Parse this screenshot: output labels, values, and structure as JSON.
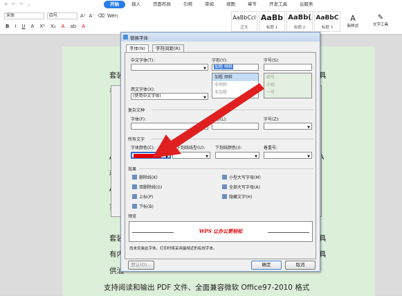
{
  "menubar": {
    "quick": [
      "✉",
      "↶",
      "↷",
      "⌄"
    ],
    "tabs": [
      "开始",
      "插入",
      "页面布局",
      "引用",
      "审阅",
      "视图",
      "章节",
      "开发工具",
      "云服务"
    ],
    "active": "开始"
  },
  "ribbon": {
    "font_name": "宋体",
    "font_size": "四号",
    "btns_row1": [
      "A⁺",
      "A⁻",
      "⌫",
      "Wén"
    ],
    "btns_row2": [
      "B",
      "I",
      "U",
      "A",
      "X²",
      "X₂",
      "A",
      "ab",
      "A"
    ],
    "styles": [
      {
        "sample": "AaBbCcl",
        "caption": "正文"
      },
      {
        "sample": "AaBb",
        "caption": "标题 1"
      },
      {
        "sample": "AaBb(",
        "caption": "标题 2"
      },
      {
        "sample": "AaBbC",
        "caption": "标题 3"
      }
    ],
    "new_style": "新样式",
    "tools": "文字工具"
  },
  "doc": {
    "lines": [
      "套装",
      "有内",
      "优",
      "A",
      "稻",
      "A",
      "首",
      "套装",
      "有内",
      "供油",
      "支持阅读和输出 PDF 文件、全面兼容微软 Office97-2010 格式"
    ],
    "right_marks": [
      "具",
      "A",
      "具",
      "具"
    ]
  },
  "dialog": {
    "title": "替换字体",
    "tabs": [
      "字体(N)",
      "字符间距(R)"
    ],
    "cn_font_label": "中文字体(T):",
    "style_label": "字形(Y):",
    "size_label": "字号(S):",
    "style_value": "加粗 倾斜",
    "style_list": [
      "加粗 倾斜",
      "非倾斜",
      "非加粗"
    ],
    "size_list": [
      "初号",
      "小初",
      "一号"
    ],
    "west_font_label": "西文字体(X):",
    "west_font_value": "(使用中文字体)",
    "complex_section": "复杂文种",
    "cfont_label": "字体(F):",
    "cstyle_label": "字形(L):",
    "csize_label": "字号(Z):",
    "all_text": "所有文字",
    "color_label": "字体颜色(C):",
    "ul_type_label": "下划线线型(U):",
    "ul_color_label": "下划线颜色(I):",
    "emphasis_label": "着重号:",
    "effects": "效果",
    "effects_list": [
      [
        "删除线(K)",
        "小型大写字母(M)"
      ],
      [
        "双删除线(G)",
        "全部大写字母(A)"
      ],
      [
        "上标(P)",
        "隐藏文字(H)"
      ],
      [
        "下标(B)",
        ""
      ]
    ],
    "preview_label": "预览",
    "preview_text": "WPS 让办公更轻松",
    "note": "尚未安装此字体，打印时将采用最相近的有效字体。",
    "default_btn": "默认(D)...",
    "ok_btn": "确定",
    "cancel_btn": "取消",
    "font_color": "#e00000",
    "accent": "#e02020"
  }
}
